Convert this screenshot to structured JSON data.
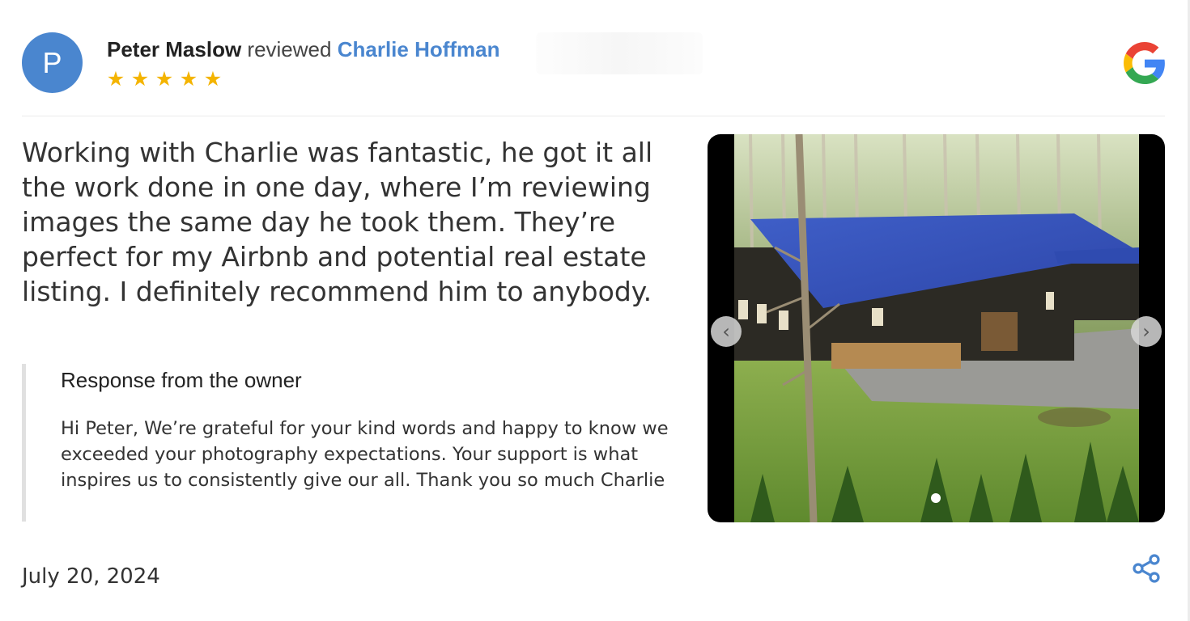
{
  "review": {
    "avatar_initial": "P",
    "reviewer_name": "Peter Maslow",
    "verb": "reviewed",
    "business_name": "Charlie Hoffman",
    "rating": 5,
    "stars": [
      "★",
      "★",
      "★",
      "★",
      "★"
    ],
    "text": "Working with Charlie was fantastic, he got it all the work done in one day, where I’m reviewing images the same day he took them. They’re perfect for my Airbnb and potential real estate listing. I definitely recommend him to anybody.",
    "date": "July 20, 2024"
  },
  "owner_response": {
    "title": "Response from the owner",
    "text": "Hi Peter, We’re grateful for your kind words and happy to know we exceeded your photography expectations. Your support is what inspires us to consistently give our all. Thank you so much Charlie"
  },
  "gallery": {
    "prev_label": "‹",
    "next_label": "›",
    "photo_count": 1,
    "current_index": 1
  },
  "icons": {
    "source": "google-logo-icon",
    "share": "share-icon"
  },
  "colors": {
    "avatar_bg": "#4a86cf",
    "business_link": "#4a86cf",
    "star": "#f4b400",
    "share_icon": "#4a86cf"
  }
}
